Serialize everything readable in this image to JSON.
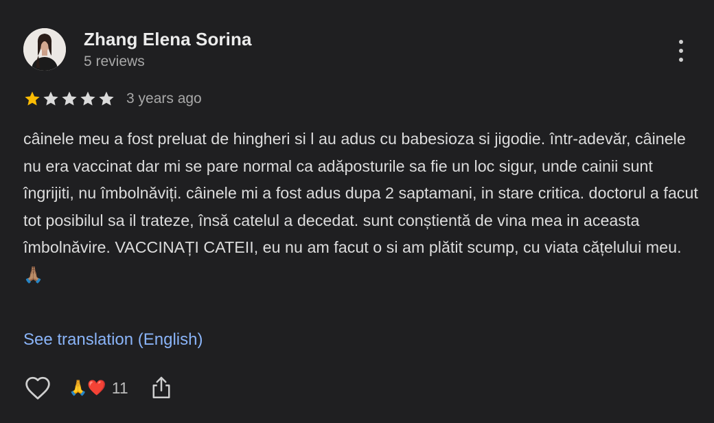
{
  "review": {
    "author": {
      "name": "Zhang Elena Sorina",
      "meta": "5 reviews"
    },
    "rating": 1,
    "rating_max": 5,
    "timestamp": "3 years ago",
    "text": "câinele meu a fost preluat de hingheri si l au adus cu babesioza si jigodie. într-adevăr, câinele nu era vaccinat dar mi se pare normal ca adăposturile sa fie un loc sigur, unde cainii sunt îngrijiti, nu îmbolnăviți. câinele mi a fost adus dupa 2 saptamani, in stare critica. doctorul a facut tot posibilul sa il trateze, însă catelul a decedat. sunt conștientă de vina mea in aceasta îmbolnăvire. VACCINAȚI CATEII, eu nu am facut o si am plătit scump, cu viata cățelului meu. 🙏🏽",
    "translate_label": "See translation (English)",
    "reactions": {
      "emoji": "🙏❤️",
      "count": "11"
    }
  },
  "colors": {
    "background": "#1f1f21",
    "star_filled": "#fbbc04",
    "star_empty": "#dadada",
    "link": "#8ab4f8"
  },
  "icons": {
    "more": "more-vert-icon",
    "like": "heart-outline-icon",
    "share": "share-icon"
  }
}
